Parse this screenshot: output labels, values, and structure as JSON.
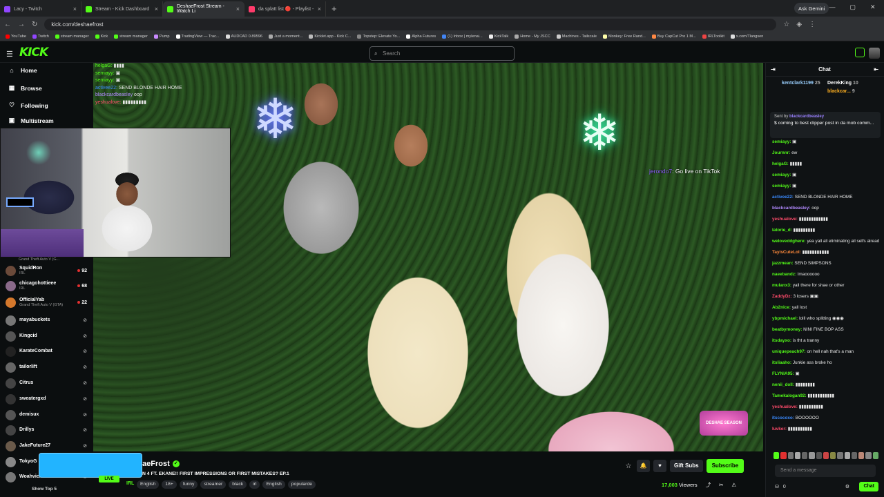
{
  "browser": {
    "tabs": [
      {
        "label": "Lacy - Twitch",
        "color": "#9146ff"
      },
      {
        "label": "Stream - Kick Dashboard",
        "color": "#53fc18"
      },
      {
        "label": "DeshaeFrost Stream - Watch Li",
        "color": "#53fc18"
      },
      {
        "label": "da splatt list 🔴 - Playlist -",
        "color": "#ff3b6b"
      }
    ],
    "new_tab": "+",
    "ask_gemini": "Ask Gemini",
    "url": "kick.com/deshaefrost",
    "bookmarks": [
      "YouTube",
      "Twitch",
      "stream manager",
      "Kick",
      "stream manager",
      "Pump",
      "TradingView — Trac...",
      "AUDCAD 0.89596",
      "Just a moment...",
      "Kicklet.app - Kick C...",
      "Topstep: Elevate Yo...",
      "Alpha Futures",
      "(1) Inbox | mylenai...",
      "KickTalk",
      "Home - My JSCC",
      "Machines - Tailscale",
      "Monkey: Free Rand...",
      "Buy CapCut Pro 1 M...",
      "IRLToolkit",
      "x.com/Tlangsen"
    ]
  },
  "kick": {
    "logo": "KICK",
    "search_placeholder": "Search"
  },
  "sidebar": {
    "nav": [
      {
        "label": "Home",
        "icon": "⌂"
      },
      {
        "label": "Browse",
        "icon": "▦"
      },
      {
        "label": "Following",
        "icon": "♡"
      },
      {
        "label": "Multistream",
        "icon": "▣"
      }
    ],
    "partial_game": "Grand Theft Auto V (G...",
    "channels": [
      {
        "name": "SquidRon",
        "game": "IRL",
        "viewers": "92",
        "color": "#6b4a3a"
      },
      {
        "name": "chicagohottieee",
        "game": "IRL",
        "viewers": "68",
        "color": "#8a6a8a"
      },
      {
        "name": "OfficialYab",
        "game": "Grand Theft Auto V (GTA)",
        "viewers": "22",
        "color": "#d4782c"
      },
      {
        "name": "mayabuckets",
        "game": "",
        "viewers": "",
        "color": "#777"
      },
      {
        "name": "Kingcid",
        "game": "",
        "viewers": "",
        "color": "#555"
      },
      {
        "name": "KarateCombat",
        "game": "",
        "viewers": "",
        "color": "#222"
      },
      {
        "name": "tailorlift",
        "game": "",
        "viewers": "",
        "color": "#666"
      },
      {
        "name": "Citrus",
        "game": "",
        "viewers": "",
        "color": "#444"
      },
      {
        "name": "sweatergxd",
        "game": "",
        "viewers": "",
        "color": "#333"
      },
      {
        "name": "demisux",
        "game": "",
        "viewers": "",
        "color": "#555"
      },
      {
        "name": "Drillys",
        "game": "",
        "viewers": "",
        "color": "#444"
      },
      {
        "name": "JakeFuture27",
        "game": "",
        "viewers": "",
        "color": "#6a5a4a"
      },
      {
        "name": "TokyoG",
        "game": "",
        "viewers": "",
        "color": "#888"
      },
      {
        "name": "Woahvick",
        "game": "",
        "viewers": "",
        "color": "#777"
      }
    ],
    "show_top": "Show Top 5"
  },
  "overlay_chat": [
    {
      "user": "helgaG:",
      "text": "▮▮▮▮",
      "color": "#53fc18"
    },
    {
      "user": "semiayy:",
      "text": "▣",
      "color": "#53fc18"
    },
    {
      "user": "semiayy:",
      "text": "▣",
      "color": "#53fc18"
    },
    {
      "user": "activee22:",
      "text": "SEND BLONDE HAIR HOME",
      "color": "#3b8bff"
    },
    {
      "user": "blackcardbeasley",
      "text": "oop",
      "color": "#b28aff"
    },
    {
      "user": "yeshualove:",
      "text": "▮▮▮▮▮▮▮▮▮",
      "color": "#ff4b6b"
    }
  ],
  "video": {
    "tiktok_user": "jerondo7",
    "tiktok_text": ": Go live on TikTok",
    "show_logo": "DESHAE SEASON"
  },
  "stream": {
    "streamer": "aeFrost",
    "title": "N 4 FT. EKANE!! FIRST IMPRESSIONS OR FIRST MISTAKES? EP.1",
    "live": "LIVE",
    "category": "IRL",
    "tags": [
      "English",
      "18+",
      "funny",
      "streamer",
      "black",
      "irl",
      "English",
      "popularde"
    ],
    "gift_subs": "Gift Subs",
    "subscribe": "Subscribe",
    "viewers": "17,003",
    "viewers_label": "Viewers"
  },
  "chat": {
    "title": "Chat",
    "leaderboard": [
      {
        "user": "kentclark1199",
        "count": "25",
        "color": "#9ad0ff"
      },
      {
        "user": "DerekKing",
        "count": "10",
        "color": "#ffffff"
      },
      {
        "user": "blackcar...",
        "count": "9",
        "color": "#ffb020"
      }
    ],
    "pinned_by": "Sent by",
    "pinned_user": "blackcardbeasley",
    "pinned_text": "$ coming to best clipper post in da mob comm...",
    "messages": [
      {
        "user": "semiayy:",
        "text": "▣",
        "color": "#53fc18"
      },
      {
        "user": "Journnr:",
        "text": "ew",
        "color": "#53fc18"
      },
      {
        "user": "helgaG:",
        "text": "▮▮▮▮▮",
        "color": "#53fc18"
      },
      {
        "user": "semiayy:",
        "text": "▣",
        "color": "#53fc18"
      },
      {
        "user": "semiayy:",
        "text": "▣",
        "color": "#53fc18"
      },
      {
        "user": "activee22:",
        "text": "SEND BLONDE HAIR HOME",
        "color": "#3b8bff"
      },
      {
        "user": "blackcardbeasley:",
        "text": "oop",
        "color": "#b28aff"
      },
      {
        "user": "yeshualove:",
        "text": "▮▮▮▮▮▮▮▮▮▮▮▮",
        "color": "#ff4b6b"
      },
      {
        "user": "latorie_d:",
        "text": "▮▮▮▮▮▮▮▮▮",
        "color": "#53fc18"
      },
      {
        "user": "weloveddghere:",
        "text": "yea yall all eliminating all selfs already smh",
        "color": "#53fc18"
      },
      {
        "user": "TayisCuteLol:",
        "text": "▮▮▮▮▮▮▮▮▮▮▮",
        "color": "#ff8a3b"
      },
      {
        "user": "jazzmean:",
        "text": "SEND SIMPSONS",
        "color": "#53fc18"
      },
      {
        "user": "naeebandz:",
        "text": "lmaoooooo",
        "color": "#53fc18"
      },
      {
        "user": "mulanx3:",
        "text": "yall there for shae or other",
        "color": "#53fc18"
      },
      {
        "user": "ZaddyDz:",
        "text": "3 losers ▣▣",
        "color": "#ff4b6b"
      },
      {
        "user": "Ab2nice:",
        "text": "yall lost",
        "color": "#53fc18"
      },
      {
        "user": "ybpmichael:",
        "text": "lolll who splitting ◉◉◉",
        "color": "#53fc18"
      },
      {
        "user": "beatbymoney:",
        "text": "NINI FINE BOP ASS",
        "color": "#53fc18"
      },
      {
        "user": "itsdayxo:",
        "text": "is tht a tranny",
        "color": "#53fc18"
      },
      {
        "user": "uniquepeach97:",
        "text": "on hell nah that's a man",
        "color": "#53fc18"
      },
      {
        "user": "itsliaaho:",
        "text": "Junkie ass broke ho",
        "color": "#53fc18"
      },
      {
        "user": "FLYNIA95:",
        "text": "▣",
        "color": "#53fc18"
      },
      {
        "user": "nenii_doll:",
        "text": "▮▮▮▮▮▮▮▮",
        "color": "#53fc18"
      },
      {
        "user": "Tamekalogan92:",
        "text": "▮▮▮▮▮▮▮▮▮▮▮",
        "color": "#53fc18"
      },
      {
        "user": "yeshualove:",
        "text": "▮▮▮▮▮▮▮▮▮▮",
        "color": "#ff4b6b"
      },
      {
        "user": "itscocoxo:",
        "text": "BOOOOOO",
        "color": "#3b8bff"
      },
      {
        "user": "luvker:",
        "text": "▮▮▮▮▮▮▮▮▮▮",
        "color": "#ff4b6b"
      }
    ],
    "input_placeholder": "Send a message",
    "points": "0",
    "chat_button": "Chat"
  }
}
